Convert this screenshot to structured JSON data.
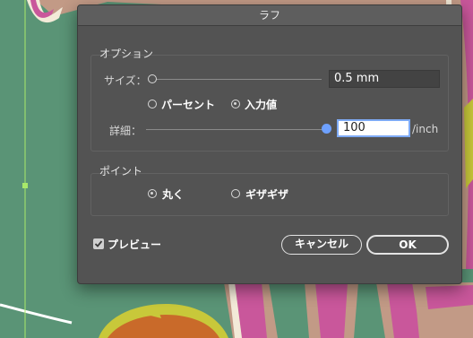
{
  "dialog": {
    "title": "ラフ",
    "options": {
      "title": "オプション",
      "size_label": "サイズ：",
      "size_value": "0.5 mm",
      "size_slider_value": 0,
      "radio_percent": "パーセント",
      "radio_absolute": "入力値",
      "radio_absolute_selected": true,
      "detail_label": "詳細：",
      "detail_value": "100",
      "detail_slider_value": 1.0,
      "detail_unit": "/inch"
    },
    "points": {
      "title": "ポイント",
      "radio_smooth": "丸く",
      "radio_corner": "ギザギザ",
      "radio_smooth_selected": true
    },
    "preview_label": "プレビュー",
    "preview_checked": true,
    "cancel_label": "キャンセル",
    "ok_label": "OK"
  },
  "colors": {
    "canvas_green": "#5a9476",
    "dialog_bg": "#535353",
    "accent_blue": "#6ea1ff",
    "pink": "#c9579b",
    "tan": "#c29a86",
    "yellow": "#c8c83a",
    "orange": "#c96a2a"
  }
}
